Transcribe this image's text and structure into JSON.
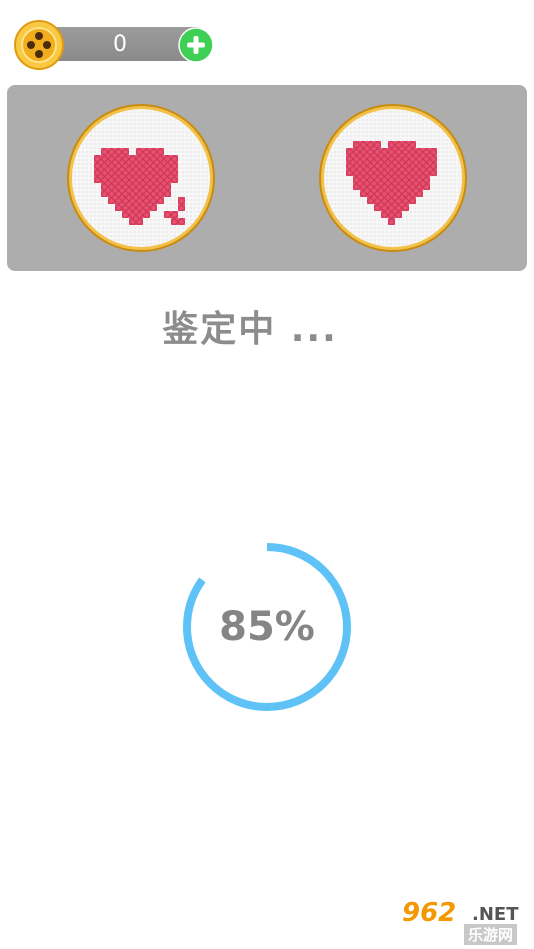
{
  "header": {
    "coin_count": "0",
    "coin_icon": "coin-icon",
    "add_icon": "plus-icon",
    "colors": {
      "bar": "#8f8f8f",
      "coin": "#f5b321",
      "add": "#3fcf55"
    }
  },
  "panel": {
    "color": "#adadad",
    "left_image": "cross-stitch-heart-with-tail",
    "right_image": "cross-stitch-heart",
    "heart_color": "#e8506e",
    "hoop_color": "#d9a22b"
  },
  "status": {
    "label": "鉴定中 ..."
  },
  "progress": {
    "value": 85,
    "label": "85%",
    "ring_color": "#5ec2f7"
  },
  "watermark": {
    "main": "962",
    "net": ".NET",
    "sub": "乐游网"
  }
}
